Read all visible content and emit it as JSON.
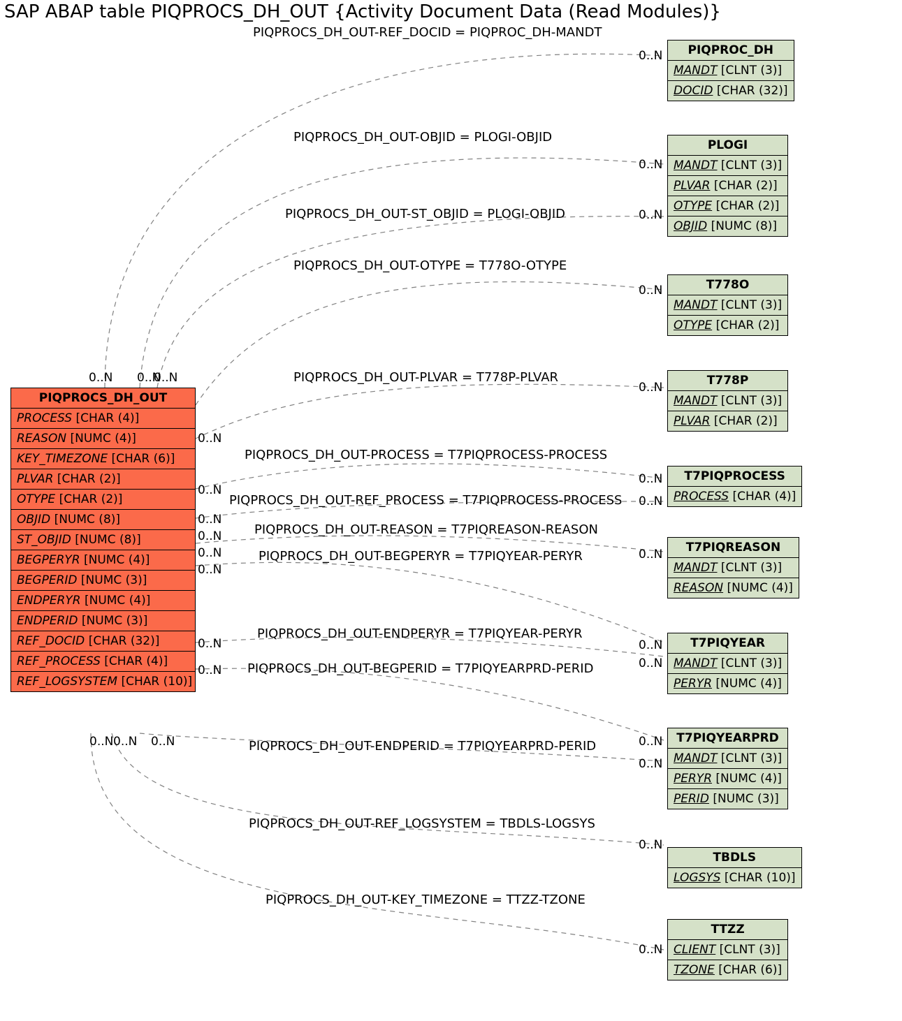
{
  "title": "SAP ABAP table PIQPROCS_DH_OUT {Activity Document Data (Read Modules)}",
  "main": {
    "name": "PIQPROCS_DH_OUT",
    "fields": [
      {
        "n": "PROCESS",
        "t": "[CHAR (4)]"
      },
      {
        "n": "REASON",
        "t": "[NUMC (4)]"
      },
      {
        "n": "KEY_TIMEZONE",
        "t": "[CHAR (6)]"
      },
      {
        "n": "PLVAR",
        "t": "[CHAR (2)]"
      },
      {
        "n": "OTYPE",
        "t": "[CHAR (2)]"
      },
      {
        "n": "OBJID",
        "t": "[NUMC (8)]"
      },
      {
        "n": "ST_OBJID",
        "t": "[NUMC (8)]"
      },
      {
        "n": "BEGPERYR",
        "t": "[NUMC (4)]"
      },
      {
        "n": "BEGPERID",
        "t": "[NUMC (3)]"
      },
      {
        "n": "ENDPERYR",
        "t": "[NUMC (4)]"
      },
      {
        "n": "ENDPERID",
        "t": "[NUMC (3)]"
      },
      {
        "n": "REF_DOCID",
        "t": "[CHAR (32)]"
      },
      {
        "n": "REF_PROCESS",
        "t": "[CHAR (4)]"
      },
      {
        "n": "REF_LOGSYSTEM",
        "t": "[CHAR (10)]"
      }
    ]
  },
  "ref": [
    {
      "name": "PIQPROC_DH",
      "fields": [
        {
          "n": "MANDT",
          "t": "[CLNT (3)]",
          "u": true
        },
        {
          "n": "DOCID",
          "t": "[CHAR (32)]",
          "u": true
        }
      ]
    },
    {
      "name": "PLOGI",
      "fields": [
        {
          "n": "MANDT",
          "t": "[CLNT (3)]",
          "u": true
        },
        {
          "n": "PLVAR",
          "t": "[CHAR (2)]",
          "u": true
        },
        {
          "n": "OTYPE",
          "t": "[CHAR (2)]",
          "u": true
        },
        {
          "n": "OBJID",
          "t": "[NUMC (8)]",
          "u": true
        }
      ]
    },
    {
      "name": "T778O",
      "fields": [
        {
          "n": "MANDT",
          "t": "[CLNT (3)]",
          "u": true
        },
        {
          "n": "OTYPE",
          "t": "[CHAR (2)]",
          "u": true
        }
      ]
    },
    {
      "name": "T778P",
      "fields": [
        {
          "n": "MANDT",
          "t": "[CLNT (3)]",
          "u": true
        },
        {
          "n": "PLVAR",
          "t": "[CHAR (2)]",
          "u": true
        }
      ]
    },
    {
      "name": "T7PIQPROCESS",
      "fields": [
        {
          "n": "PROCESS",
          "t": "[CHAR (4)]",
          "u": true
        }
      ]
    },
    {
      "name": "T7PIQREASON",
      "fields": [
        {
          "n": "MANDT",
          "t": "[CLNT (3)]",
          "u": true
        },
        {
          "n": "REASON",
          "t": "[NUMC (4)]",
          "u": true
        }
      ]
    },
    {
      "name": "T7PIQYEAR",
      "fields": [
        {
          "n": "MANDT",
          "t": "[CLNT (3)]",
          "u": true
        },
        {
          "n": "PERYR",
          "t": "[NUMC (4)]",
          "u": true
        }
      ]
    },
    {
      "name": "T7PIQYEARPRD",
      "fields": [
        {
          "n": "MANDT",
          "t": "[CLNT (3)]",
          "u": true
        },
        {
          "n": "PERYR",
          "t": "[NUMC (4)]",
          "u": true
        },
        {
          "n": "PERID",
          "t": "[NUMC (3)]",
          "u": true
        }
      ]
    },
    {
      "name": "TBDLS",
      "fields": [
        {
          "n": "LOGSYS",
          "t": "[CHAR (10)]",
          "u": true
        }
      ]
    },
    {
      "name": "TTZZ",
      "fields": [
        {
          "n": "CLIENT",
          "t": "[CLNT (3)]",
          "u": true
        },
        {
          "n": "TZONE",
          "t": "[CHAR (6)]",
          "u": true
        }
      ]
    }
  ],
  "edges": [
    {
      "label": "PIQPROCS_DH_OUT-REF_DOCID = PIQPROC_DH-MANDT"
    },
    {
      "label": "PIQPROCS_DH_OUT-OBJID = PLOGI-OBJID"
    },
    {
      "label": "PIQPROCS_DH_OUT-ST_OBJID = PLOGI-OBJID"
    },
    {
      "label": "PIQPROCS_DH_OUT-OTYPE = T778O-OTYPE"
    },
    {
      "label": "PIQPROCS_DH_OUT-PLVAR = T778P-PLVAR"
    },
    {
      "label": "PIQPROCS_DH_OUT-PROCESS = T7PIQPROCESS-PROCESS"
    },
    {
      "label": "PIQPROCS_DH_OUT-REF_PROCESS = T7PIQPROCESS-PROCESS"
    },
    {
      "label": "PIQPROCS_DH_OUT-REASON = T7PIQREASON-REASON"
    },
    {
      "label": "PIQPROCS_DH_OUT-BEGPERYR = T7PIQYEAR-PERYR"
    },
    {
      "label": "PIQPROCS_DH_OUT-ENDPERYR = T7PIQYEAR-PERYR"
    },
    {
      "label": "PIQPROCS_DH_OUT-BEGPERID = T7PIQYEARPRD-PERID"
    },
    {
      "label": "PIQPROCS_DH_OUT-ENDPERID = T7PIQYEARPRD-PERID"
    },
    {
      "label": "PIQPROCS_DH_OUT-REF_LOGSYSTEM = TBDLS-LOGSYS"
    },
    {
      "label": "PIQPROCS_DH_OUT-KEY_TIMEZONE = TTZZ-TZONE"
    }
  ],
  "card": "0..N"
}
